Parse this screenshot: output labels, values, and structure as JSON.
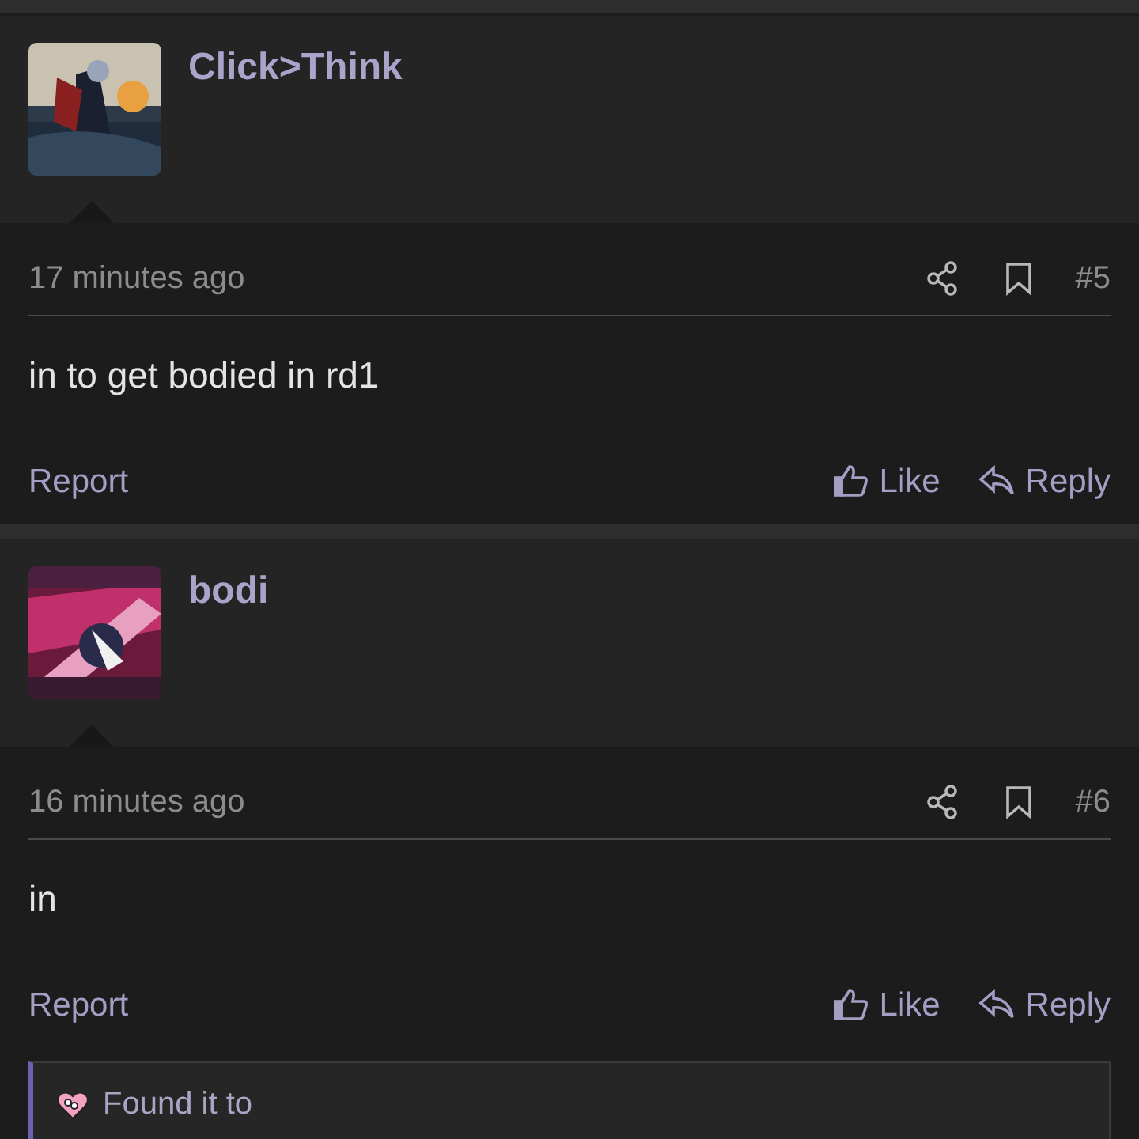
{
  "posts": [
    {
      "username": "Click>Think",
      "time": "17 minutes ago",
      "number": "#5",
      "message": "in to get bodied in rd1",
      "report": "Report",
      "like": "Like",
      "reply": "Reply"
    },
    {
      "username": "bodi",
      "time": "16 minutes ago",
      "number": "#6",
      "message": "in",
      "report": "Report",
      "like": "Like",
      "reply": "Reply"
    }
  ],
  "quote": {
    "text": "Found it to"
  }
}
